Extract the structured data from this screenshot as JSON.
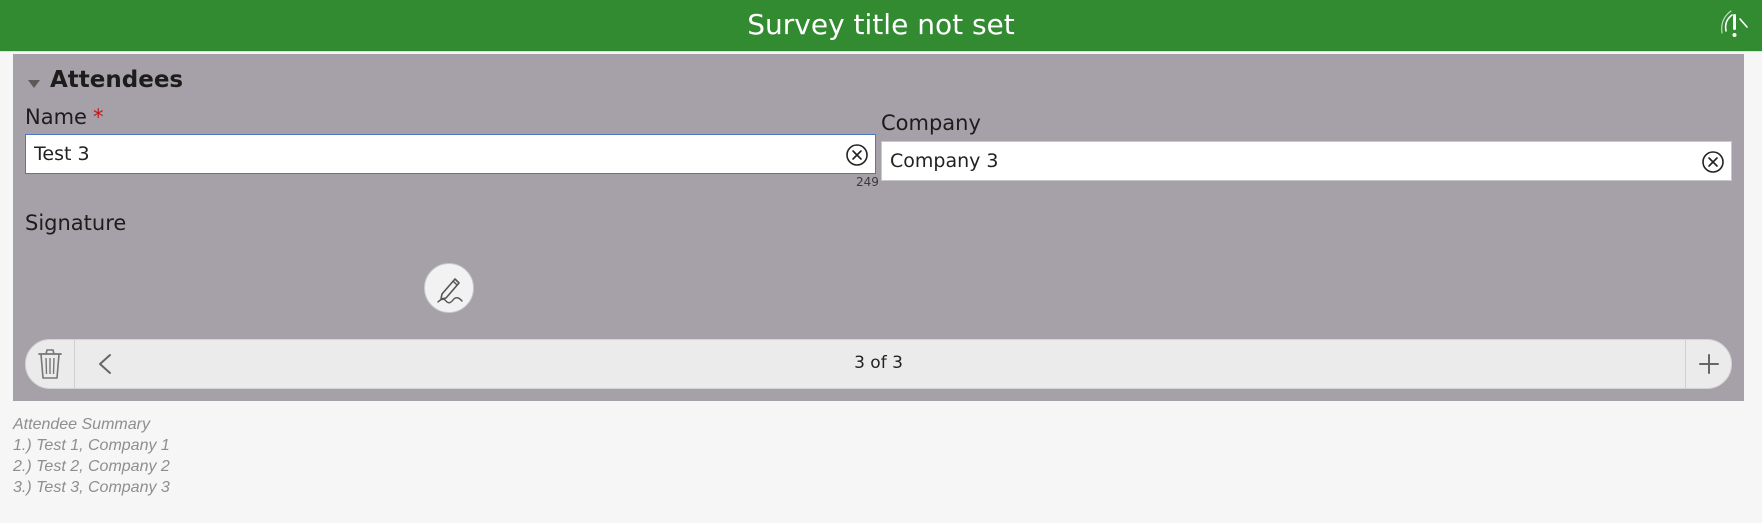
{
  "header": {
    "title": "Survey title not set"
  },
  "group": {
    "title": "Attendees"
  },
  "name_field": {
    "label": "Name",
    "required_marker": "*",
    "value": "Test 3",
    "remaining_chars": "249"
  },
  "company_field": {
    "label": "Company",
    "value": "Company 3"
  },
  "signature": {
    "label": "Signature"
  },
  "repeat": {
    "position": "3 of 3"
  },
  "summary": {
    "title": "Attendee Summary",
    "lines": [
      "1.) Test 1, Company 1",
      "2.) Test 2, Company 2",
      "3.) Test 3, Company 3"
    ]
  },
  "colors": {
    "header_bg": "#328a31",
    "panel_bg": "#a6a1a8",
    "required": "#c0171a",
    "focus_border": "#4a78c7"
  },
  "icons": [
    "tracking-status-icon",
    "collapse-triangle-icon",
    "clear-icon",
    "signature-pen-icon",
    "trash-icon",
    "chevron-left-icon",
    "plus-icon"
  ]
}
